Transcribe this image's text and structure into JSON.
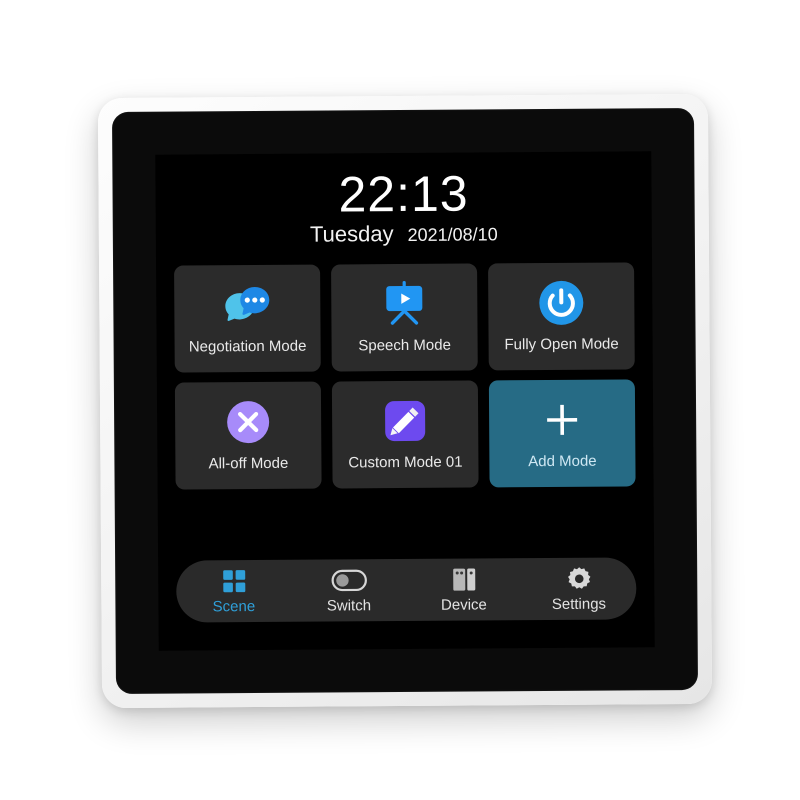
{
  "device": {
    "name": "smart-wall-panel",
    "frame_color": "#f4f4f4",
    "bezel_color": "#0b0b0b",
    "screen_color": "#000000"
  },
  "clock": {
    "time": "22:13",
    "weekday": "Tuesday",
    "date": "2021/08/10"
  },
  "modes": [
    {
      "label": "Negotiation Mode",
      "icon": "chat-bubbles-icon",
      "accent": false,
      "colors": {
        "primary": "#1e88e5",
        "secondary": "#4fc3ea"
      }
    },
    {
      "label": "Speech Mode",
      "icon": "presentation-play-icon",
      "accent": false,
      "colors": {
        "primary": "#2196f3",
        "secondary": "#2196f3"
      }
    },
    {
      "label": "Fully Open Mode",
      "icon": "power-icon",
      "accent": false,
      "colors": {
        "primary": "#2196e8",
        "secondary": "#ffffff"
      }
    },
    {
      "label": "All-off Mode",
      "icon": "close-circle-icon",
      "accent": false,
      "colors": {
        "primary": "#a78bfa",
        "secondary": "#ffffff"
      }
    },
    {
      "label": "Custom Mode 01",
      "icon": "pencil-icon",
      "accent": false,
      "colors": {
        "primary": "#6d4aef",
        "secondary": "#ffffff"
      }
    },
    {
      "label": "Add Mode",
      "icon": "plus-icon",
      "accent": true,
      "colors": {
        "primary": "#266b85",
        "secondary": "#ffffff"
      }
    }
  ],
  "nav": {
    "active_index": 0,
    "items": [
      {
        "label": "Scene",
        "icon": "grid-squares-icon",
        "active": true
      },
      {
        "label": "Switch",
        "icon": "toggle-off-icon",
        "active": false
      },
      {
        "label": "Device",
        "icon": "device-panels-icon",
        "active": false
      },
      {
        "label": "Settings",
        "icon": "gear-icon",
        "active": false
      }
    ]
  },
  "colors": {
    "tile_bg": "#2b2b2b",
    "accent_tile_bg": "#266b85",
    "nav_bg": "#2a2a2a",
    "active_nav": "#2f9fd8",
    "text": "#e9e9e9"
  }
}
